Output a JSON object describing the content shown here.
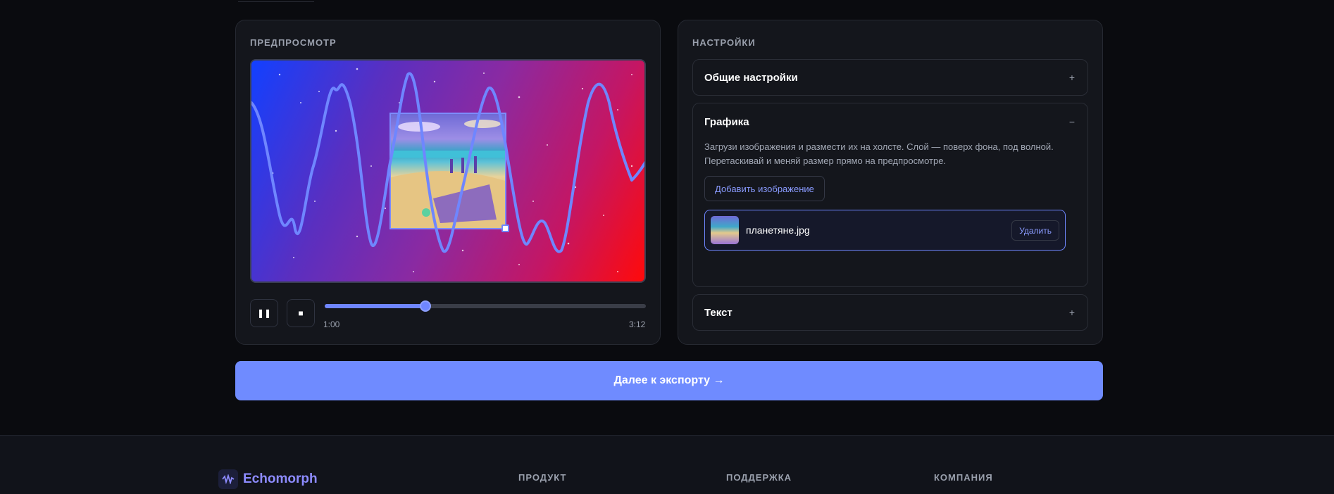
{
  "preview": {
    "heading": "ПРЕДПРОСМОТР",
    "playback": {
      "current_time": "1:00",
      "total_time": "3:12",
      "progress": 0.3125
    }
  },
  "settings": {
    "heading": "НАСТРОЙКИ",
    "sections": {
      "general": {
        "title": "Общие настройки",
        "toggle": "+"
      },
      "graphics": {
        "title": "Графика",
        "toggle": "−",
        "description": "Загрузи изображения и размести их на холсте. Слой — поверх фона, под волной. Перетаскивай и меняй размер прямо на предпросмотре.",
        "add_button": "Добавить изображение",
        "layers": [
          {
            "name": "планетяне.jpg",
            "delete_label": "Удалить"
          }
        ]
      },
      "text": {
        "title": "Текст",
        "toggle": "+"
      }
    }
  },
  "cta": {
    "label": "Далее к экспорту →"
  },
  "footer": {
    "brand": "Echomorph",
    "columns": [
      "ПРОДУКТ",
      "ПОДДЕРЖКА",
      "КОМПАНИЯ"
    ]
  },
  "colors": {
    "accent": "#6f8bff",
    "background": "#0a0b0f",
    "panel": "#14161c",
    "wave": "#6f86ff"
  }
}
